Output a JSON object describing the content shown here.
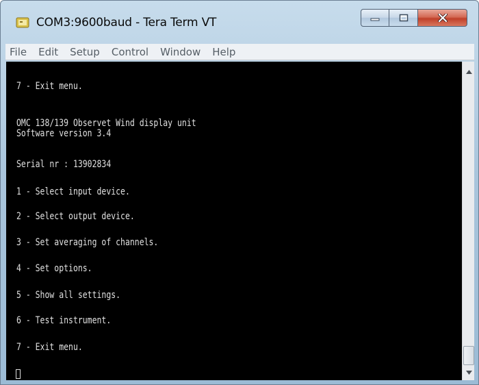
{
  "window": {
    "title": "COM3:9600baud - Tera Term VT",
    "icon": "tera-term-app-icon"
  },
  "caption_buttons": {
    "minimize_icon": "minimize-icon",
    "maximize_icon": "maximize-icon",
    "close_icon": "close-icon"
  },
  "menubar": {
    "items": [
      "File",
      "Edit",
      "Setup",
      "Control",
      "Window",
      "Help"
    ]
  },
  "terminal": {
    "lines": [
      "7 - Exit menu.",
      "",
      "",
      "OMC 138/139 Observet Wind display unit",
      "Software version 3.4",
      "",
      "Serial nr : 13902834",
      "",
      "1 - Select input device.",
      "",
      "2 - Select output device.",
      "",
      "3 - Set averaging of channels.",
      "",
      "4 - Set options.",
      "",
      "5 - Show all settings.",
      "",
      "6 - Test instrument.",
      "",
      "7 - Exit menu.",
      ""
    ]
  },
  "scrollbar": {
    "up_icon": "scroll-up-arrow-icon",
    "down_icon": "scroll-down-arrow-icon"
  },
  "colors": {
    "terminal_bg": "#000000",
    "terminal_fg": "#e0e0e0",
    "close_button": "#c0402a",
    "title_bar": "#a9c5dc"
  }
}
